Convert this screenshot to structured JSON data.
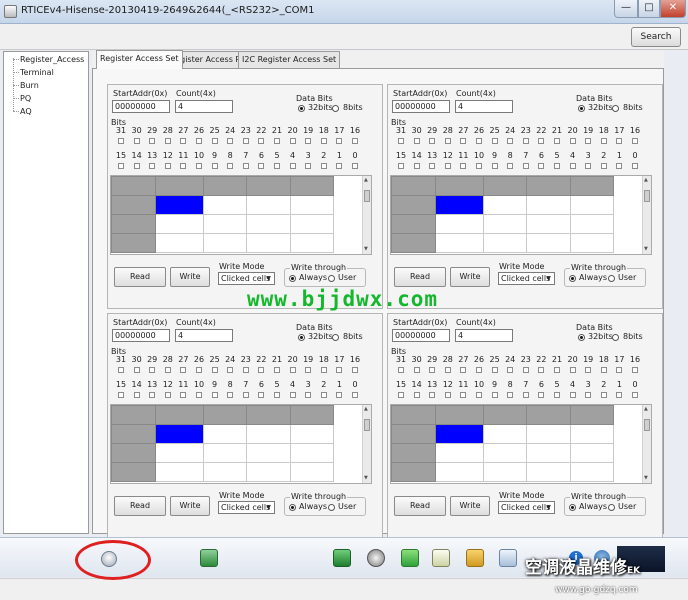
{
  "window": {
    "title": "RTICEv4-Hisense-20130419-2649&2644(_<RS232>_COM1",
    "minimize_glyph": "—",
    "maximize_glyph": "□",
    "close_glyph": "✕"
  },
  "toolbar": {
    "search_label": "Search"
  },
  "tree": {
    "items": [
      "Register_Access",
      "Terminal",
      "Burn",
      "PQ",
      "AQ"
    ]
  },
  "tabs": [
    "Register Access Set",
    "Register Access Port",
    "I2C Register Access Set"
  ],
  "panel": {
    "start_addr_label": "StartAddr(0x)",
    "start_addr_value": "00000000",
    "count_label": "Count(4x)",
    "count_value": "4",
    "data_bits_label": "Data Bits",
    "bits32_label": "32bits",
    "bits8_label": "8bits",
    "bits_label": "Bits",
    "bit_row1": [
      "31",
      "30",
      "29",
      "28",
      "27",
      "26",
      "25",
      "24",
      "23",
      "22",
      "21",
      "20",
      "19",
      "18",
      "17",
      "16"
    ],
    "bit_row2": [
      "15",
      "14",
      "13",
      "12",
      "11",
      "10",
      "9",
      "8",
      "7",
      "6",
      "5",
      "4",
      "3",
      "2",
      "1",
      "0"
    ],
    "read_label": "Read",
    "write_label": "Write",
    "write_mode_label": "Write Mode",
    "write_mode_value": "Clicked cells",
    "write_through_label": "Write through",
    "always_label": "Always",
    "user_label": "User"
  },
  "watermark": "www.bjjdwx.com",
  "brand": {
    "name": "空调液晶维修",
    "suffix": "EK",
    "url": "www.go-gdzq.com"
  },
  "colors": {
    "selected_cell": "#0000ff",
    "header_cell": "#a0a0a0",
    "highlight_circle": "#e02020",
    "watermark": "#15b82c"
  },
  "icons": [
    "windows-start-icon",
    "monitor-icon",
    "green-app-icon",
    "disk-icon",
    "download-icon",
    "notepad-icon",
    "folder-icon",
    "document-icon",
    "info-icon",
    "network-icon"
  ]
}
